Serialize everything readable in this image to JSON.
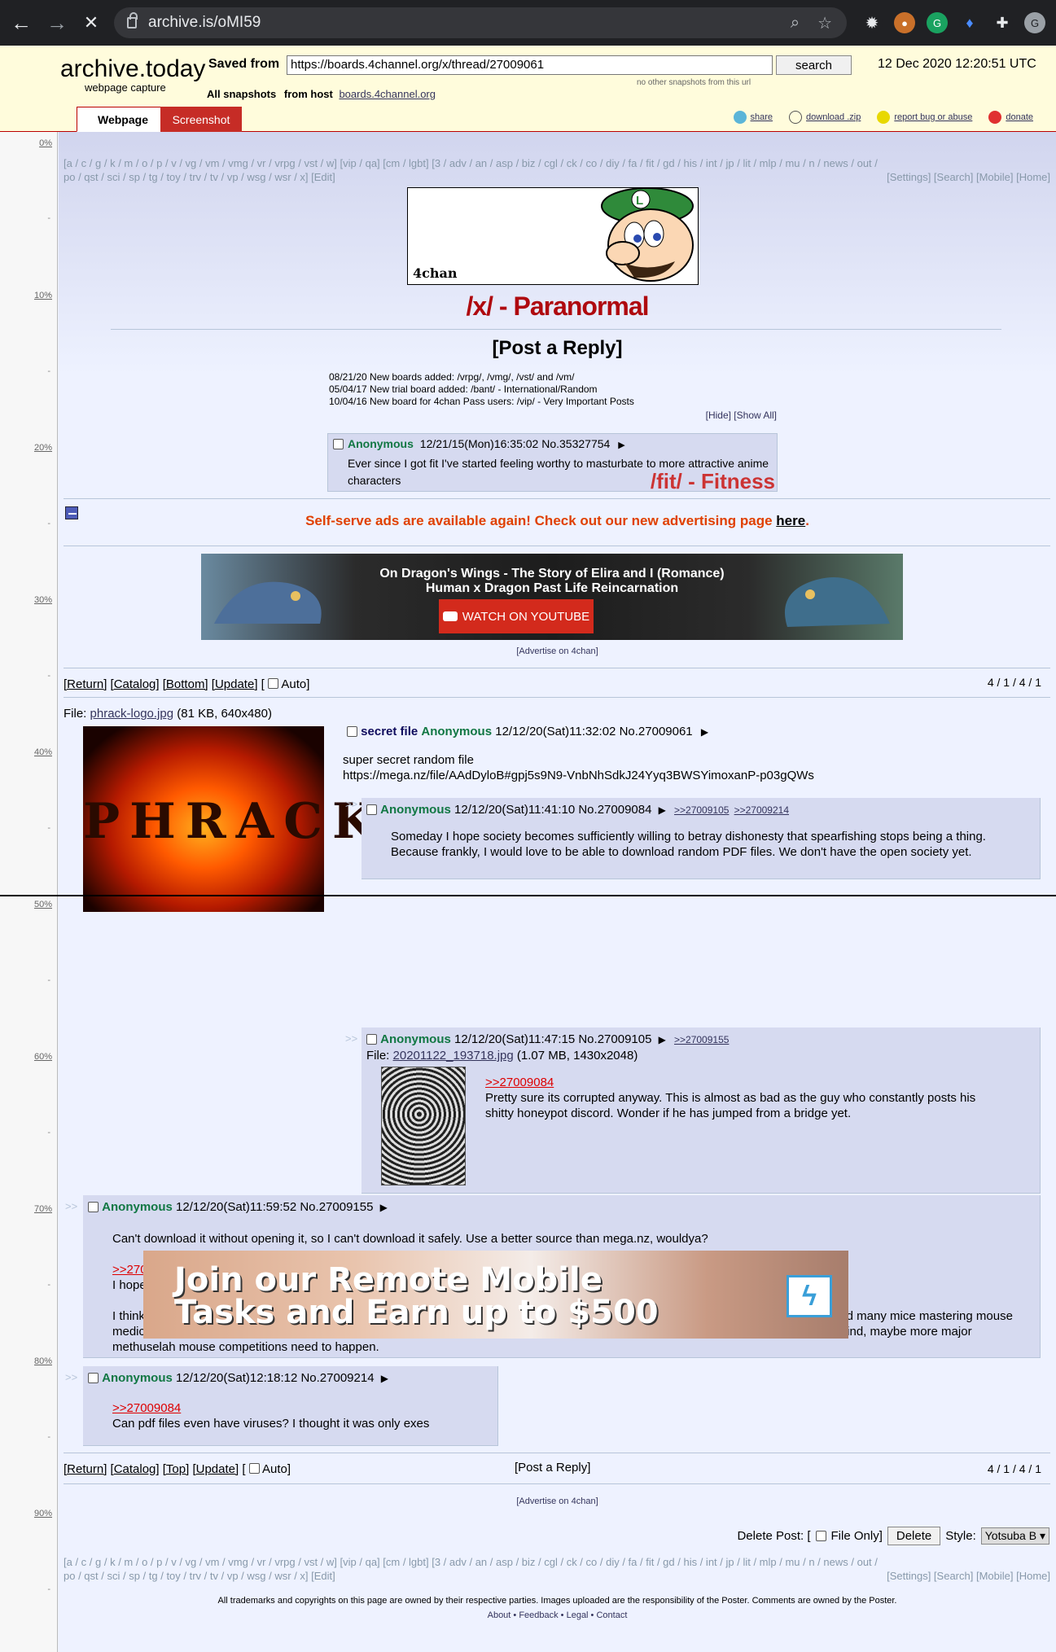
{
  "browser": {
    "url": "archive.is/oMI59"
  },
  "archive": {
    "logo": "archive.today",
    "logo_sub": "webpage capture",
    "saved_from_label": "Saved from",
    "saved_from_url": "https://boards.4channel.org/x/thread/27009061",
    "search_label": "search",
    "no_other": "no other snapshots from this url",
    "date": "12 Dec 2020 12:20:51 UTC",
    "all_snapshots_label": "All snapshots",
    "from_host_label": "from host",
    "host": "boards.4channel.org",
    "tabs": [
      "Webpage",
      "Screenshot"
    ],
    "actions": [
      "share",
      "download .zip",
      "report bug or abuse",
      "donate"
    ]
  },
  "gutter": [
    "0%",
    "10%",
    "20%",
    "30%",
    "40%",
    "50%",
    "60%",
    "70%",
    "80%",
    "90%"
  ],
  "boardlist": {
    "line1": "[a / c / g / k / m / o / p / v / vg / vm / vmg / vr / vrpg / vst / w] [vip / qa] [cm / lgbt] [3 / adv / an / asp / biz / cgl / ck / co / diy / fa / fit / gd / his / int / jp / lit / mlp / mu / n / news / out /",
    "line2": "po / qst / sci / sp / tg / toy / trv / tv / vp / wsg / wsr / x] [Edit]",
    "right": "[Settings] [Search] [Mobile] [Home]"
  },
  "banner_tag": "4chan",
  "board_title": "/x/ - Paranormal",
  "post_reply": "[Post a Reply]",
  "news": [
    "08/21/20 New boards added: /vrpg/, /vmg/, /vst/ and /vm/",
    "05/04/17 New trial board added: /bant/ - International/Random",
    "10/04/16 New board for 4chan Pass users: /vip/ - Very Important Posts"
  ],
  "news_hide": "[Hide] [Show All]",
  "mini_post": {
    "name": "Anonymous",
    "meta": "12/21/15(Mon)16:35:02 No.35327754",
    "body": "Ever since I got fit I've started feeling worthy to masturbate to more attractive anime characters",
    "ad_title": "/fit/ - Fitness"
  },
  "selfserve": {
    "text": "Self-serve ads are available again! Check out our new advertising page",
    "link": "here",
    "end": "."
  },
  "ad1": {
    "line1": "On Dragon's Wings - The Story of Elira and I (Romance)",
    "line2": "Human x Dragon Past Life Reincarnation",
    "cta": "WATCH ON YOUTUBE"
  },
  "advertise": "[Advertise on 4chan]",
  "nav_top": {
    "return": "[Return]",
    "catalog": "[Catalog]",
    "bottom": "[Bottom]",
    "update": "[Update]",
    "auto": "Auto]",
    "auto_open": "["
  },
  "nav_bottom": {
    "return": "[Return]",
    "catalog": "[Catalog]",
    "top": "[Top]",
    "update": "[Update]",
    "auto": "Auto]",
    "auto_open": "[",
    "post_reply": "[Post a Reply]"
  },
  "pages": "4 / 1 / 4 / 1",
  "op": {
    "file_label": "File:",
    "file_name": "phrack-logo.jpg",
    "file_info": "(81 KB, 640x480)",
    "subject": "secret file",
    "name": "Anonymous",
    "meta": "12/12/20(Sat)11:32:02 No.27009061",
    "body1": "super secret random file",
    "body2": "https://mega.nz/file/AAdDyloB#gpj5s9N9-VnbNhSdkJ24Yyq3BWSYimoxanP-p03gQWs",
    "image_text": "PHRACK"
  },
  "replies": [
    {
      "name": "Anonymous",
      "meta": "12/12/20(Sat)11:41:10 No.27009084",
      "backlinks": [
        ">>27009105",
        ">>27009214"
      ],
      "body": "Someday I hope society becomes sufficiently willing to betray dishonesty that spearfishing stops being a thing. Because frankly, I would love to be able to download random PDF files. We don't have the open society yet."
    },
    {
      "name": "Anonymous",
      "meta": "12/12/20(Sat)11:47:15 No.27009105",
      "backlinks": [
        ">>27009155"
      ],
      "file_label": "File:",
      "file_name": "20201122_193718.jpg",
      "file_info": "(1.07 MB, 1430x2048)",
      "quote": ">>27009084",
      "body": "Pretty sure its corrupted anyway. This is almost as bad as the guy who constantly posts his shitty honeypot discord. Wonder if he has jumped from a bridge yet."
    },
    {
      "name": "Anonymous",
      "meta": "12/12/20(Sat)11:59:52 No.27009155",
      "body_a": "Can't download it without opening it, so I can't download it safely. Use a better source than mega.nz, wouldya?",
      "quote": ">>27009105",
      "body_b": "I hope not; we're pretty close to serious rejuvenation techs IRL. Every death today is the loss of one who might have been immortal.",
      "body_c": "I think if the best data were pulled together from all available sources, we could make a mouse live for a hundred years... we've murdered many mice mastering mouse medicine, and human medicine lags behind, but we did the mouse things in prayer of healing humans. Ever read about ISRIB? By my mind, maybe more major methuselah mouse competitions need to happen."
    },
    {
      "name": "Anonymous",
      "meta": "12/12/20(Sat)12:18:12 No.27009214",
      "quote": ">>27009084",
      "body": "Can pdf files even have viruses? I thought it was only exes"
    }
  ],
  "ad2": {
    "line1": "Join our Remote Mobile",
    "line2": "Tasks and Earn up to $500"
  },
  "delete_bar": {
    "label": "Delete Post: [",
    "file_only": "File Only]",
    "delete": "Delete",
    "style_label": "Style:",
    "style_value": "Yotsuba B"
  },
  "footer": {
    "line1": "All trademarks and copyrights on this page are owned by their respective parties. Images uploaded are the responsibility of the Poster. Comments are owned by the Poster.",
    "line2": "About • Feedback • Legal • Contact"
  }
}
